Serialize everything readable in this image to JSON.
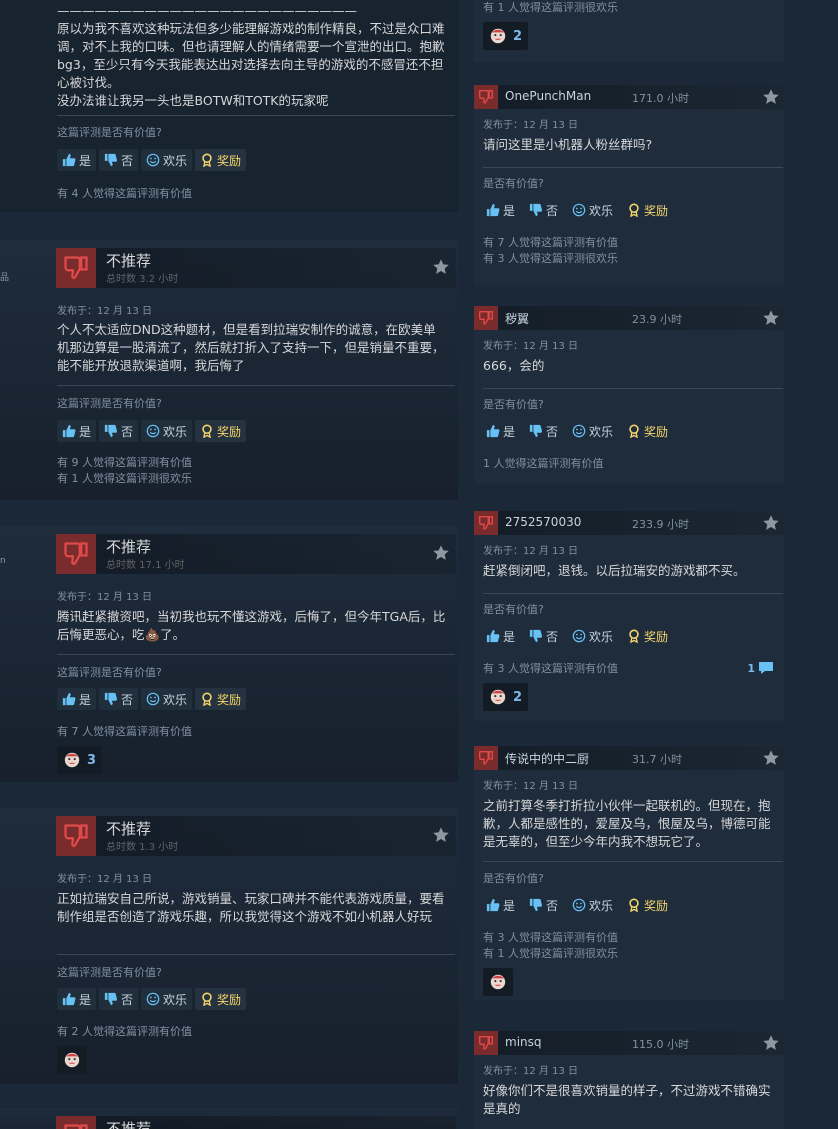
{
  "labels": {
    "helpful_q_left": "这篇评测是否有价值?",
    "helpful_q_right": "是否有价值?",
    "yes": "是",
    "no": "否",
    "funny": "欢乐",
    "award": "奖励",
    "not_recommended": "不推荐"
  },
  "left_reviews": [
    {
      "body": "————————————————————————\n原以为我不喜欢这种玩法但多少能理解游戏的制作精良，不过是众口难调，对不上我的口味。但也请理解人的情绪需要一个宣泄的出口。抱歉bg3，至少只有今天我能表达出对选择去向主导的游戏的不感冒还不担心被讨伐。\n没办法谁让我另一头也是BOTW和TOTK的玩家呢",
      "counts": [
        "有 4 人觉得这篇评测有价值"
      ]
    },
    {
      "edge": "品",
      "hours": "总时数 3.2 小时",
      "posted": "发布于：12 月 13 日",
      "body": "个人不太适应DND这种题材，但是看到拉瑞安制作的诚意，在欧美单机那边算是一股清流了，然后就打折入了支持一下，但是销量不重要，能不能开放退款渠道啊，我后悔了",
      "counts": [
        "有 9 人觉得这篇评测有价值",
        "有 1 人觉得这篇评测很欢乐"
      ]
    },
    {
      "edge": "n",
      "hours": "总时数 17.1 小时",
      "posted": "发布于：12 月 13 日",
      "body": "腾讯赶紧撤资吧，当初我也玩不懂这游戏，后悔了，但今年TGA后，比后悔更恶心，吃💩了。",
      "counts": [
        "有 7 人觉得这篇评测有价值"
      ],
      "reaction": "3"
    },
    {
      "hours": "总时数 1.3 小时",
      "posted": "发布于：12 月 13 日",
      "body": "正如拉瑞安自己所说，游戏销量、玩家口碑并不能代表游戏质量，要看制作组是否创造了游戏乐趣，所以我觉得这个游戏不如小机器人好玩",
      "counts": [
        "有 2 人觉得这篇评测有价值"
      ]
    }
  ],
  "right_top": {
    "count": "有 1 人觉得这篇评测很欢乐",
    "reaction": "2"
  },
  "right_reviews": [
    {
      "user": "OnePunchMan",
      "hours": "171.0 小时",
      "posted": "发布于：12 月 13 日",
      "body": "请问这里是小机器人粉丝群吗?",
      "counts": [
        "有 7 人觉得这篇评测有价值",
        "有 3 人觉得这篇评测很欢乐"
      ]
    },
    {
      "user": "秽翼",
      "hours": "23.9 小时",
      "posted": "发布于：12 月 13 日",
      "body": "666，会的",
      "counts": [
        "1 人觉得这篇评测有价值"
      ]
    },
    {
      "user": "2752570030",
      "hours": "233.9 小时",
      "posted": "发布于：12 月 13 日",
      "body": "赶紧倒闭吧，退钱。以后拉瑞安的游戏都不买。",
      "counts": [
        "有 3 人觉得这篇评测有价值"
      ],
      "comments": "1",
      "reaction": "2"
    },
    {
      "user": "传说中的中二厨",
      "hours": "31.7 小时",
      "posted": "发布于：12 月 13 日",
      "body": "之前打算冬季打折拉小伙伴一起联机的。但现在，抱歉，人都是感性的，爱屋及乌，恨屋及乌，博德可能是无辜的，但至少今年内我不想玩它了。",
      "counts": [
        "有 3 人觉得这篇评测有价值",
        "有 1 人觉得这篇评测很欢乐"
      ]
    },
    {
      "user": "minsq",
      "hours": "115.0 小时",
      "posted": "发布于：12 月 13 日",
      "body": "好像你们不是很喜欢销量的样子，不过游戏不错确实是真的"
    }
  ],
  "colors": {
    "background": "#1b2838",
    "thumb_down": "#7a2b2b",
    "link_blue": "#7fb8ea",
    "award_gold": "#f5d56b"
  }
}
